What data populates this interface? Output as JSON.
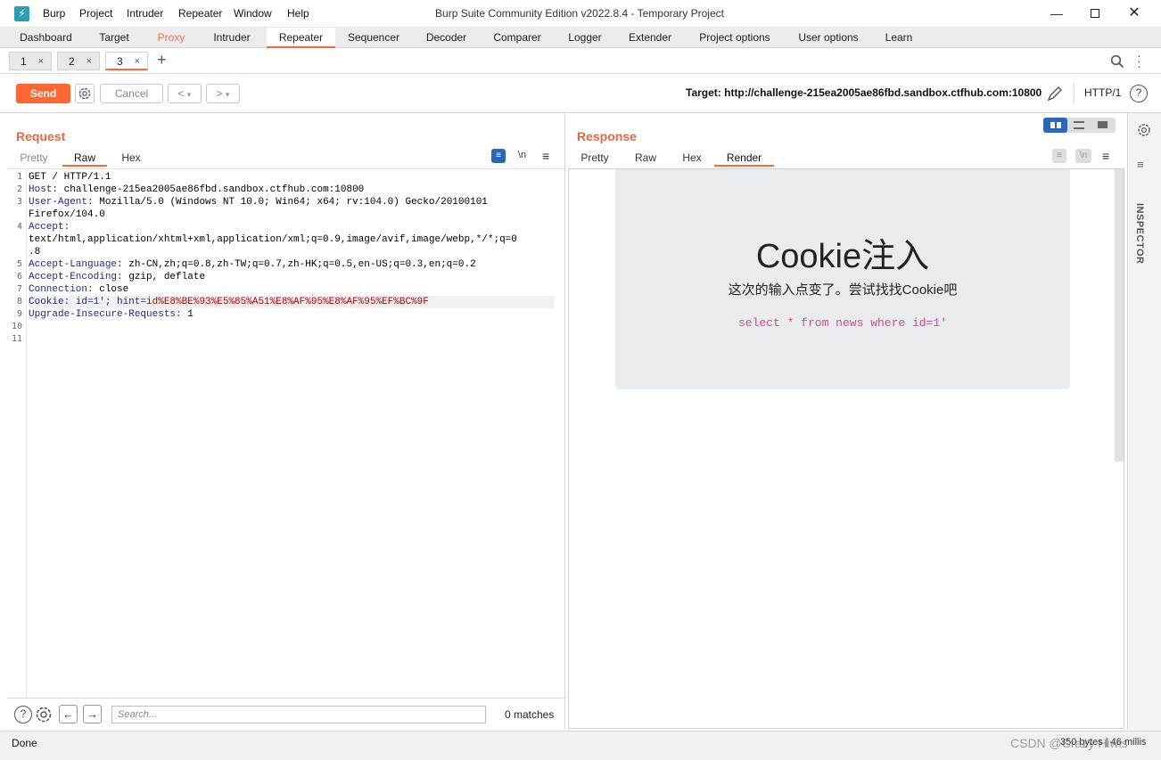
{
  "app": {
    "logo": "⚡",
    "title": "Burp Suite Community Edition v2022.8.4 - Temporary Project",
    "menu": [
      "Burp",
      "Project",
      "Intruder",
      "Repeater",
      "Window",
      "Help"
    ]
  },
  "module_tabs": [
    "Dashboard",
    "Target",
    "Proxy",
    "Intruder",
    "Repeater",
    "Sequencer",
    "Decoder",
    "Comparer",
    "Logger",
    "Extender",
    "Project options",
    "User options",
    "Learn"
  ],
  "active_module": "Repeater",
  "repeater_tabs": [
    {
      "label": "1",
      "close": "×"
    },
    {
      "label": "2",
      "close": "×"
    },
    {
      "label": "3",
      "close": "×"
    }
  ],
  "toolbar": {
    "send": "Send",
    "cancel": "Cancel",
    "back": "<",
    "forward": ">",
    "dropdown": "▾",
    "target": "Target: http://challenge-215ea2005ae86fbd.sandbox.ctfhub.com:10800",
    "http_version": "HTTP/1"
  },
  "request": {
    "title": "Request",
    "tabs": [
      "Pretty",
      "Raw",
      "Hex"
    ],
    "active_tab": "Raw",
    "newline_toggle": "\\n",
    "line_numbers": [
      "1",
      "2",
      "3",
      "",
      "4",
      "",
      "",
      "5",
      "6",
      "7",
      "8",
      "9",
      "10",
      "11"
    ],
    "lines": [
      {
        "key": "GET / HTTP/1.1",
        "val": ""
      },
      {
        "key": "Host:",
        "val": " challenge-215ea2005ae86fbd.sandbox.ctfhub.com:10800"
      },
      {
        "key": "User-Agent:",
        "val": " Mozilla/5.0 (Windows NT 10.0; Win64; x64; rv:104.0) Gecko/20100101"
      },
      {
        "key": "",
        "val": "Firefox/104.0"
      },
      {
        "key": "Accept:",
        "val": ""
      },
      {
        "key": "",
        "val": "text/html,application/xhtml+xml,application/xml;q=0.9,image/avif,image/webp,*/*;q=0"
      },
      {
        "key": "",
        "val": ".8"
      },
      {
        "key": "Accept-Language:",
        "val": " zh-CN,zh;q=0.8,zh-TW;q=0.7,zh-HK;q=0.5,en-US;q=0.3,en;q=0.2"
      },
      {
        "key": "Accept-Encoding:",
        "val": " gzip, deflate"
      },
      {
        "key": "Connection:",
        "val": " close"
      },
      {
        "key": "Cookie: id=1';",
        "val": " hint=",
        "cookie": "id%E8%BE%93%E5%85%A51%E8%AF%95%E8%AF%95%EF%BC%9F"
      },
      {
        "key": "Upgrade-Insecure-Requests:",
        "val": " 1"
      },
      {
        "key": "",
        "val": ""
      },
      {
        "key": "",
        "val": ""
      }
    ],
    "search_placeholder": "Search...",
    "matches": "0 matches"
  },
  "response": {
    "title": "Response",
    "tabs": [
      "Pretty",
      "Raw",
      "Hex",
      "Render"
    ],
    "active_tab": "Render",
    "newline_toggle": "\\n",
    "render": {
      "heading": "Cookie注入",
      "subtitle": "这次的输入点变了。尝试找找Cookie吧",
      "sql": "select * from news where id=1'"
    }
  },
  "inspector": {
    "label": "INSPECTOR"
  },
  "status": {
    "left": "Done",
    "right": "350 bytes | 46 millis",
    "watermark": "CSDN @Crazy Hiwis"
  }
}
